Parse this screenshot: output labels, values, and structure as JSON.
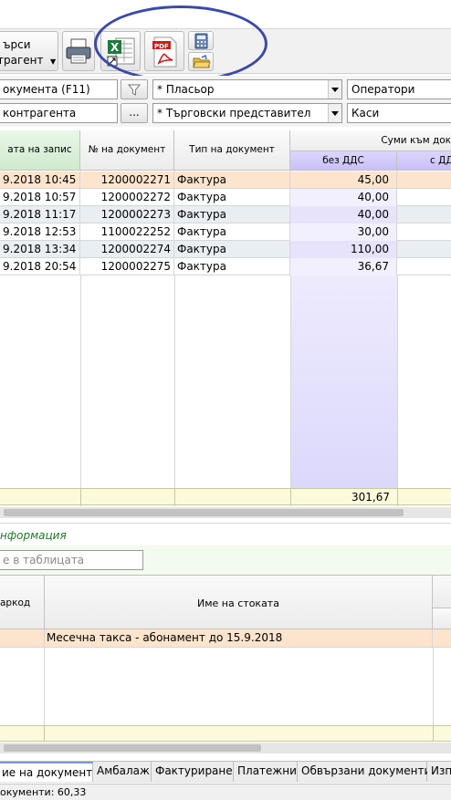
{
  "toolbar": {
    "search_label_1": "ърси",
    "search_label_2": "трагент"
  },
  "filters": {
    "doc_field": "окумента (F11)",
    "counterparty_field": "контрагента",
    "dots": "...",
    "placer": "* Пласьор",
    "sales_rep": "* Търговски представител",
    "operators": "Оператори",
    "cash": "Каси"
  },
  "grid": {
    "headers": {
      "date": "ата на запис",
      "doc_no": "№ на документ",
      "doc_type": "Тип на документ",
      "sums_group": "Суми към док",
      "no_vat": "без ДДС",
      "with_vat": "с ДД"
    },
    "rows": [
      {
        "date": "9.2018 10:45",
        "doc_no": "1200002271",
        "type": "Фактура",
        "amount": "45,00"
      },
      {
        "date": "9.2018 10:57",
        "doc_no": "1200002272",
        "type": "Фактура",
        "amount": "40,00"
      },
      {
        "date": "9.2018 11:17",
        "doc_no": "1200002273",
        "type": "Фактура",
        "amount": "40,00"
      },
      {
        "date": "9.2018 12:53",
        "doc_no": "1100022252",
        "type": "Фактура",
        "amount": "30,00"
      },
      {
        "date": "9.2018 13:34",
        "doc_no": "1200002274",
        "type": "Фактура",
        "amount": "110,00"
      },
      {
        "date": "9.2018 20:54",
        "doc_no": "1200002275",
        "type": "Фактура",
        "amount": "36,67"
      }
    ],
    "total": "301,67"
  },
  "info": {
    "label": "нформация",
    "search_placeholder": "е в таблицата"
  },
  "items": {
    "headers": {
      "barcode": "аркод",
      "name": "Име на стоката"
    },
    "rows": [
      {
        "name": "Месечна такса  - абонамент до  15.9.2018"
      }
    ]
  },
  "tabs": [
    "ие на документа",
    "Амбалаж",
    "Фактуриране",
    "Платежни",
    "Обвързани документи",
    "Изп"
  ],
  "status": "окументи: 60,33"
}
